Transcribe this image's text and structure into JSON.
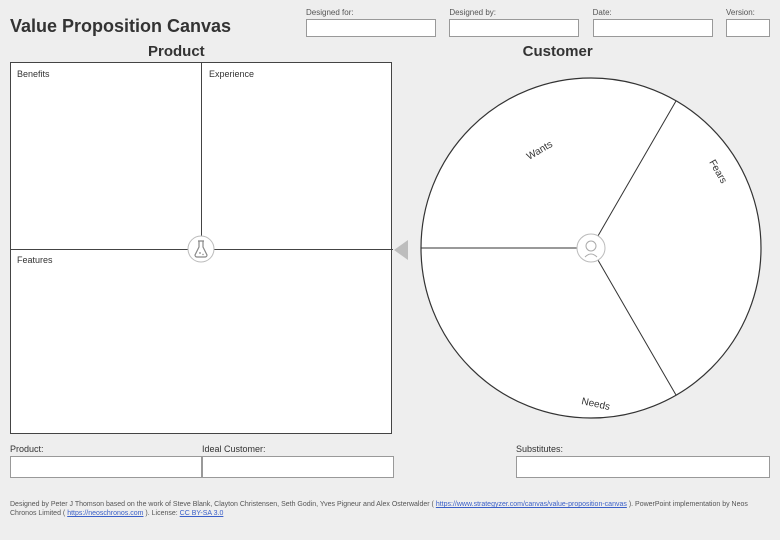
{
  "title": "Value Proposition Canvas",
  "header_fields": {
    "designed_for_label": "Designed for:",
    "designed_by_label": "Designed by:",
    "date_label": "Date:",
    "version_label": "Version:",
    "designed_for_value": "",
    "designed_by_value": "",
    "date_value": "",
    "version_value": ""
  },
  "sections": {
    "product_title": "Product",
    "customer_title": "Customer"
  },
  "product": {
    "benefits_label": "Benefits",
    "experience_label": "Experience",
    "features_label": "Features"
  },
  "customer": {
    "wants_label": "Wants",
    "fears_label": "Fears",
    "needs_label": "Needs"
  },
  "bottom": {
    "product_label": "Product:",
    "ideal_customer_label": "Ideal Customer:",
    "substitutes_label": "Substitutes:",
    "product_value": "",
    "ideal_customer_value": "",
    "substitutes_value": ""
  },
  "footer": {
    "text_a": "Designed by Peter J Thomson based on the work of Steve Blank, Clayton Christensen, Seth Godin, Yves Pigneur and Alex Osterwalder (",
    "link1_text": "https://www.strategyzer.com/canvas/value-proposition-canvas",
    "text_b": "). PowerPoint implementation by Neos Chronos Limited (",
    "link2_text": "https://neoschronos.com",
    "text_c": "). License: ",
    "link3_text": "CC BY-SA 3.0"
  }
}
